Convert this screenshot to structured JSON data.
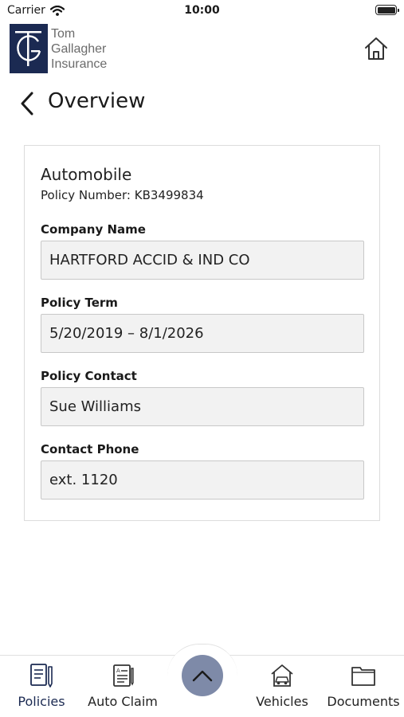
{
  "status_bar": {
    "carrier": "Carrier",
    "time": "10:00",
    "icons": [
      "wifi-icon",
      "battery-icon"
    ]
  },
  "header": {
    "logo_lines": [
      "Tom",
      "Gallagher",
      "Insurance"
    ],
    "logo_monogram": "TG",
    "brand_color": "#1b2a52",
    "home_icon": "home-icon"
  },
  "page": {
    "title": "Overview",
    "back_icon": "chevron-left-icon"
  },
  "policy": {
    "type": "Automobile",
    "number_text": "Policy Number: KB3499834",
    "fields": [
      {
        "label": "Company Name",
        "value": "HARTFORD ACCID & IND CO"
      },
      {
        "label": "Policy Term",
        "value": "5/20/2019 – 8/1/2026"
      },
      {
        "label": "Policy Contact",
        "value": "Sue Williams"
      },
      {
        "label": "Contact Phone",
        "value": "ext. 1120"
      }
    ]
  },
  "tab_bar": {
    "tabs": [
      {
        "label": "Policies",
        "icon": "policies-icon",
        "active": true
      },
      {
        "label": "Auto Claim",
        "icon": "auto-claim-icon",
        "active": false
      },
      {
        "label": "Vehicles",
        "icon": "vehicles-icon",
        "active": false
      },
      {
        "label": "Documents",
        "icon": "documents-icon",
        "active": false
      }
    ],
    "center_button_icon": "chevron-up-icon",
    "center_button_color": "#7e8aa8"
  }
}
